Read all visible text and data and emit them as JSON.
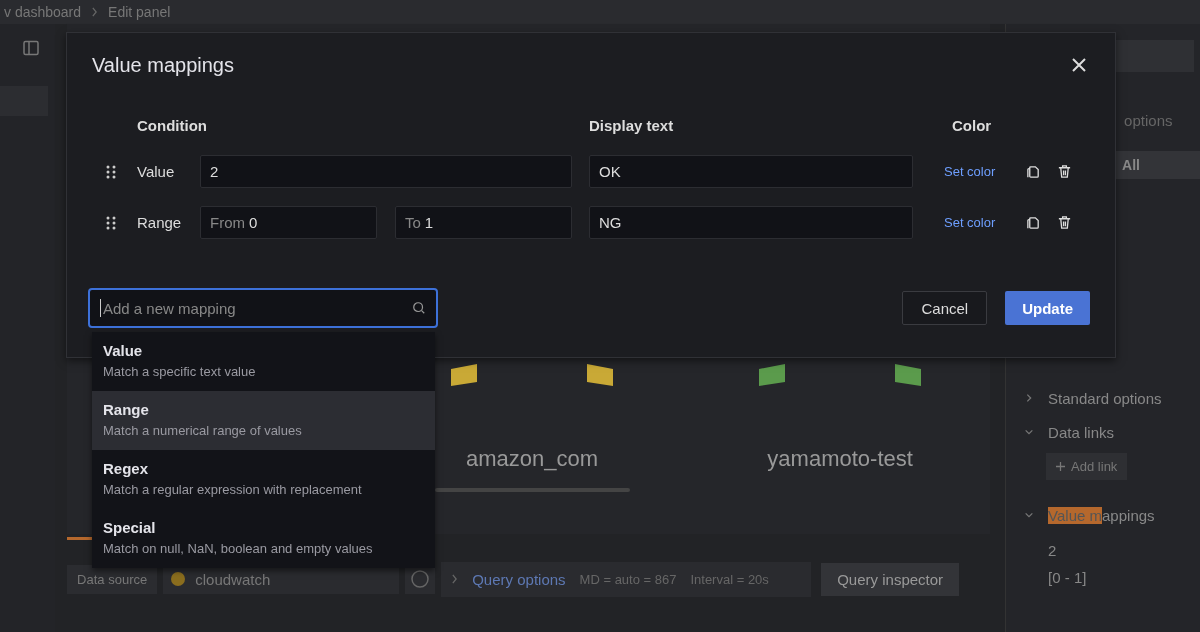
{
  "breadcrumb": [
    "v dashboard",
    "Edit panel"
  ],
  "preview": {
    "stats": [
      {
        "color": "#c9a936",
        "name": "amazon_com"
      },
      {
        "color": "#5b9b4c",
        "name": "yamamoto-test"
      }
    ]
  },
  "query_bar": {
    "data_source_label": "Data source",
    "data_source": "cloudwatch",
    "query_options": "Query options",
    "max_data_points": "MD = auto = 867",
    "interval": "Interval = 20s",
    "inspector": "Query inspector"
  },
  "options_pane": {
    "search_text": "options",
    "filter": "All",
    "sections": [
      {
        "title": "Standard options",
        "expanded": false
      },
      {
        "title": "Data links",
        "expanded": true,
        "button": "Add link"
      },
      {
        "title_highlight": "Value m",
        "title_rest": "appings",
        "expanded": true,
        "items": [
          "2",
          "[0 - 1]"
        ]
      }
    ]
  },
  "modal": {
    "title": "Value mappings",
    "columns": [
      "Condition",
      "Display text",
      "Color"
    ],
    "rows": [
      {
        "kind": "value",
        "label": "Value",
        "value": "2",
        "display": "OK",
        "color_link": "Set color"
      },
      {
        "kind": "range",
        "label": "Range",
        "from_label": "From",
        "from": "0",
        "to_label": "To",
        "to": "1",
        "display": "NG",
        "color_link": "Set color"
      }
    ],
    "add_placeholder": "Add a new mapping",
    "cancel": "Cancel",
    "update": "Update"
  },
  "dropdown": [
    {
      "title": "Value",
      "description": "Match a specific text value",
      "selected": false
    },
    {
      "title": "Range",
      "description": "Match a numerical range of values",
      "selected": true
    },
    {
      "title": "Regex",
      "description": "Match a regular expression with replacement",
      "selected": false
    },
    {
      "title": "Special",
      "description": "Match on null, NaN, boolean and empty values",
      "selected": false
    }
  ]
}
